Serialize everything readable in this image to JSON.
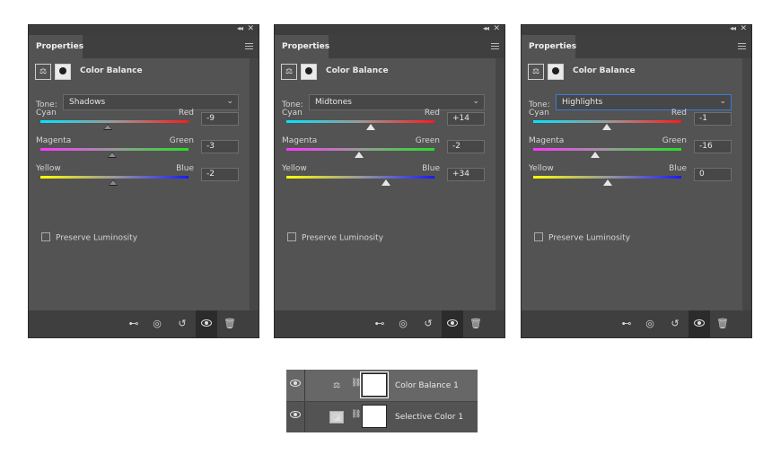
{
  "panels": [
    {
      "tab": "Properties",
      "title": "Color Balance",
      "tone_label": "Tone:",
      "tone": "Shadows",
      "tone_focused": false,
      "sliders": [
        {
          "left": "Cyan",
          "right": "Red",
          "value": "-9",
          "position": -9
        },
        {
          "left": "Magenta",
          "right": "Green",
          "value": "-3",
          "position": -3
        },
        {
          "left": "Yellow",
          "right": "Blue",
          "value": "-2",
          "position": -2
        }
      ],
      "preserve_label": "Preserve Luminosity",
      "preserve_checked": false
    },
    {
      "tab": "Properties",
      "title": "Color Balance",
      "tone_label": "Tone:",
      "tone": "Midtones",
      "tone_focused": false,
      "sliders": [
        {
          "left": "Cyan",
          "right": "Red",
          "value": "+14",
          "position": 14
        },
        {
          "left": "Magenta",
          "right": "Green",
          "value": "-2",
          "position": -2
        },
        {
          "left": "Yellow",
          "right": "Blue",
          "value": "+34",
          "position": 34
        }
      ],
      "preserve_label": "Preserve Luminosity",
      "preserve_checked": false
    },
    {
      "tab": "Properties",
      "title": "Color Balance",
      "tone_label": "Tone:",
      "tone": "Highlights",
      "tone_focused": true,
      "sliders": [
        {
          "left": "Cyan",
          "right": "Red",
          "value": "-1",
          "position": -1
        },
        {
          "left": "Magenta",
          "right": "Green",
          "value": "-16",
          "position": -16
        },
        {
          "left": "Yellow",
          "right": "Blue",
          "value": "0",
          "position": 0
        }
      ],
      "preserve_label": "Preserve Luminosity",
      "preserve_checked": false
    }
  ],
  "slider_range": [
    -100,
    100
  ],
  "gradients": {
    "cyan_red": [
      "#00e5ff",
      "#ff1a1a"
    ],
    "magenta_green": [
      "#ff33ff",
      "#22e022"
    ],
    "yellow_blue": [
      "#ffff00",
      "#1a1aff"
    ]
  },
  "footer_icons": [
    "clip-to-layer-icon",
    "view-previous-state-icon",
    "reset-icon",
    "visibility-icon",
    "trash-icon"
  ],
  "layers": [
    {
      "name": "Color Balance 1",
      "icon": "color-balance-icon",
      "selected": true,
      "visible": true
    },
    {
      "name": "Selective Color 1",
      "icon": "selective-color-icon",
      "selected": false,
      "visible": true
    }
  ]
}
